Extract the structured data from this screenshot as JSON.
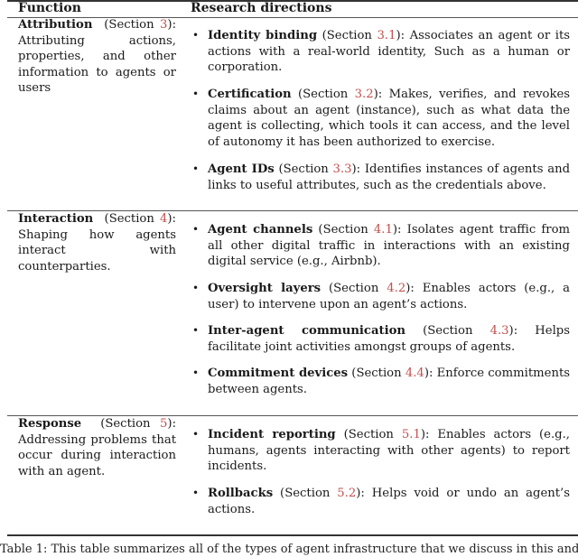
{
  "table": {
    "headers": {
      "function": "Function",
      "research": "Research directions"
    },
    "rows": [
      {
        "function_name": "Attribution",
        "section_prefix": "(Section ",
        "section_ref": "3",
        "section_suffix": "):",
        "description": "Attributing actions, properties, and other information to agents or users",
        "items": [
          {
            "name": "Identity binding",
            "prefix": " (Section ",
            "ref": "3.1",
            "suffix": "): ",
            "text": "Associates an agent or its actions with a real-world identity, Such as a human or corporation."
          },
          {
            "name": "Certification",
            "prefix": " (Section ",
            "ref": "3.2",
            "suffix": "): ",
            "text": "Makes, verifies, and revokes claims about an agent (instance), such as what data the agent is collecting, which tools it can access, and the level of autonomy it has been authorized to exercise."
          },
          {
            "name": "Agent IDs",
            "prefix": " (Section ",
            "ref": "3.3",
            "suffix": "): ",
            "text": "Identifies instances of agents and links to useful attributes, such as the credentials above."
          }
        ]
      },
      {
        "function_name": "Interaction",
        "section_prefix": "(Section ",
        "section_ref": "4",
        "section_suffix": "):",
        "description": "Shaping how agents interact with counterparties.",
        "items": [
          {
            "name": "Agent channels",
            "prefix": " (Section ",
            "ref": "4.1",
            "suffix": "): ",
            "text": "Isolates agent traffic from all other digital traffic in interactions with an existing digital service (e.g., Airbnb)."
          },
          {
            "name": "Oversight layers",
            "prefix": " (Section ",
            "ref": "4.2",
            "suffix": "): ",
            "text": "Enables actors (e.g., a user) to intervene upon an agent’s actions."
          },
          {
            "name": "Inter-agent communication",
            "prefix": " (Section ",
            "ref": "4.3",
            "suffix": "): ",
            "text": "Helps facilitate joint activities amongst groups of agents."
          },
          {
            "name": "Commitment devices",
            "prefix": " (Section ",
            "ref": "4.4",
            "suffix": "): ",
            "text": "Enforce commitments between agents."
          }
        ]
      },
      {
        "function_name": "Response",
        "section_prefix": "(Section ",
        "section_ref": "5",
        "section_suffix": "):",
        "description": "Addressing problems that occur during interaction with an agent.",
        "items": [
          {
            "name": "Incident reporting",
            "prefix": " (Section ",
            "ref": "5.1",
            "suffix": "): ",
            "text": "Enables actors (e.g., humans, agents interacting with other agents) to report incidents."
          },
          {
            "name": "Rollbacks",
            "prefix": " (Section ",
            "ref": "5.2",
            "suffix": "): ",
            "text": "Helps void or undo an agent’s actions."
          }
        ]
      }
    ],
    "bullet": "•",
    "caption": "Table 1: This table summarizes all of the types of agent infrastructure that we discuss in this and"
  }
}
